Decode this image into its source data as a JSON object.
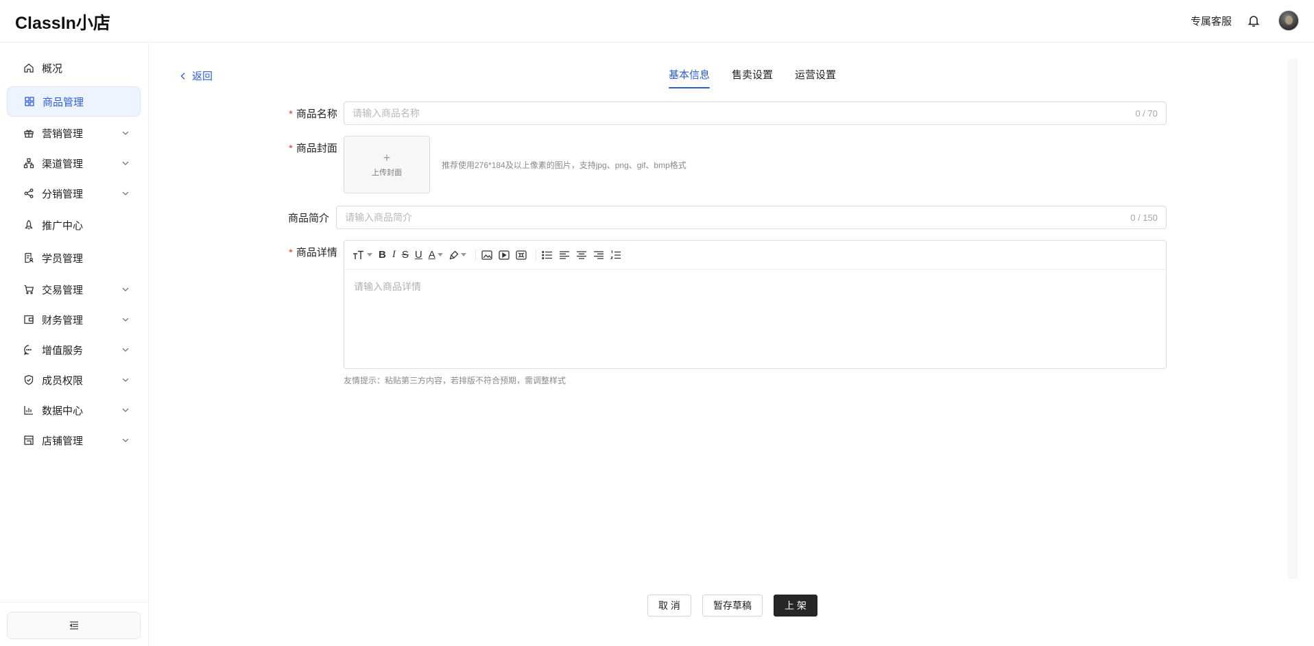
{
  "app": {
    "title": "ClassIn小店"
  },
  "header": {
    "service_label": "专属客服",
    "icons": {
      "bell": "bell-icon",
      "avatar": "user-avatar"
    }
  },
  "sidebar": {
    "items": [
      {
        "label": "概况",
        "icon": "home-icon",
        "expandable": false,
        "active": false
      },
      {
        "label": "商品管理",
        "icon": "grid-icon",
        "expandable": false,
        "active": true
      },
      {
        "label": "营销管理",
        "icon": "gift-icon",
        "expandable": true,
        "active": false
      },
      {
        "label": "渠道管理",
        "icon": "hierarchy-icon",
        "expandable": true,
        "active": false
      },
      {
        "label": "分销管理",
        "icon": "share-icon",
        "expandable": true,
        "active": false
      },
      {
        "label": "推广中心",
        "icon": "rocket-icon",
        "expandable": false,
        "active": false
      },
      {
        "label": "学员管理",
        "icon": "document-user-icon",
        "expandable": false,
        "active": false
      },
      {
        "label": "交易管理",
        "icon": "cart-icon",
        "expandable": true,
        "active": false
      },
      {
        "label": "财务管理",
        "icon": "wallet-icon",
        "expandable": true,
        "active": false
      },
      {
        "label": "增值服务",
        "icon": "chat-dots-icon",
        "expandable": true,
        "active": false
      },
      {
        "label": "成员权限",
        "icon": "shield-check-icon",
        "expandable": true,
        "active": false
      },
      {
        "label": "数据中心",
        "icon": "bar-chart-icon",
        "expandable": true,
        "active": false
      },
      {
        "label": "店铺管理",
        "icon": "store-icon",
        "expandable": true,
        "active": false
      }
    ],
    "collapse_icon": "menu-collapse-icon"
  },
  "main": {
    "back_label": "返回",
    "tabs": [
      {
        "label": "基本信息",
        "active": true
      },
      {
        "label": "售卖设置",
        "active": false
      },
      {
        "label": "运营设置",
        "active": false
      }
    ],
    "form": {
      "name": {
        "label": "商品名称",
        "required": "*",
        "placeholder": "请输入商品名称",
        "counter": "0 / 70",
        "value": ""
      },
      "cover": {
        "label": "商品封面",
        "required": "*",
        "upload_plus": "+",
        "upload_label": "上传封面",
        "hint": "推荐使用276*184及以上像素的图片，支持jpg、png、gif、bmp格式"
      },
      "intro": {
        "label": "商品简介",
        "placeholder": "请输入商品简介",
        "counter": "0 / 150",
        "value": ""
      },
      "detail": {
        "label": "商品详情",
        "required": "*",
        "placeholder": "请输入商品详情",
        "tip": "友情提示：粘贴第三方内容，若排版不符合预期，需调整样式",
        "toolbar": [
          "font-size-icon",
          "bold-icon",
          "italic-icon",
          "strikethrough-icon",
          "underline-icon",
          "font-color-icon",
          "highlight-icon",
          "image-icon",
          "video-icon",
          "attachment-icon",
          "bullet-list-icon",
          "align-left-icon",
          "align-center-icon",
          "align-right-icon",
          "ordered-list-icon"
        ],
        "toolbar_glyphs": {
          "bold": "B",
          "italic": "I",
          "underline": "U",
          "strike": "S",
          "color": "A"
        }
      }
    },
    "actions": {
      "cancel": "取 消",
      "draft": "暂存草稿",
      "publish": "上 架"
    }
  },
  "colors": {
    "accent": "#2b5fd9",
    "primary_button": "#262626",
    "required": "#e53935"
  }
}
